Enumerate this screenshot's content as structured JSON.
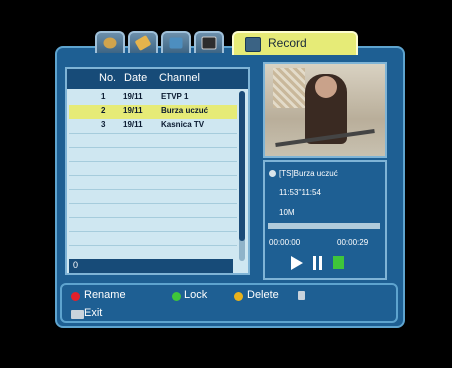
{
  "tabs": {
    "record_label": "Record"
  },
  "list": {
    "headers": {
      "no": "No.",
      "date": "Date",
      "channel": "Channel"
    },
    "rows": [
      {
        "no": "1",
        "date": "19/11",
        "channel": "ETVP 1"
      },
      {
        "no": "2",
        "date": "19/11",
        "channel": "Burza uczuć"
      },
      {
        "no": "3",
        "date": "19/11",
        "channel": "Kasnica TV"
      }
    ],
    "selected_index": 1,
    "footer_value": "0"
  },
  "preview": {
    "title": "[TS]Burza uczuć",
    "time_range": "11:53''11:54",
    "size": "10M",
    "elapsed": "00:00:00",
    "total": "00:00:29",
    "progress": 0
  },
  "colors": {
    "highlight": "#e6eb77",
    "red": "#e4202a",
    "green": "#3fc63a",
    "yellow": "#e9b21b"
  },
  "bottom": {
    "rename": "Rename",
    "lock": "Lock",
    "delete": "Delete",
    "exit": "Exit"
  }
}
